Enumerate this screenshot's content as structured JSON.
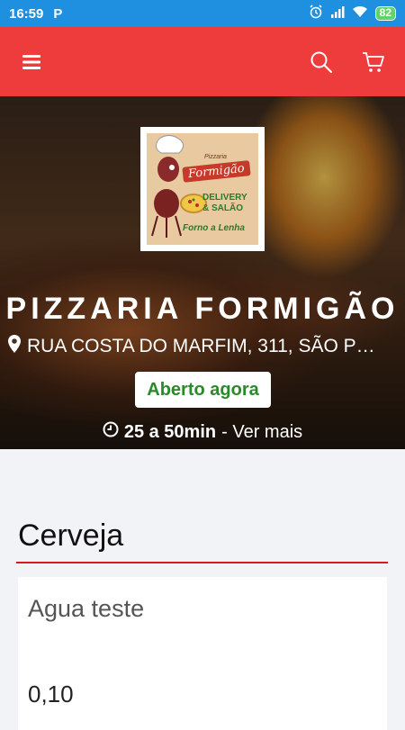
{
  "status_bar": {
    "time": "16:59",
    "app_icon": "P",
    "battery": "82"
  },
  "app_bar": {
    "menu_icon": "menu-icon",
    "search_icon": "search-icon",
    "cart_icon": "cart-icon",
    "accent_color": "#ee3b3b"
  },
  "store": {
    "logo": {
      "pretitle": "Pizzaria",
      "brand": "Formigão",
      "service_line1": "DELIVERY",
      "service_line2": "& SALÃO",
      "tagline": "Forno a Lenha"
    },
    "name": "PIZZARIA FORMIGÃO",
    "address": "RUA COSTA DO MARFIM, 311, SÃO P…",
    "status_label": "Aberto agora",
    "status_color": "#2a8a2a",
    "delivery_time": "25 a 50min",
    "more_link": "- Ver mais"
  },
  "menu": {
    "category": "Cerveja",
    "products": [
      {
        "name": "Agua teste",
        "price": "0,10"
      }
    ]
  }
}
